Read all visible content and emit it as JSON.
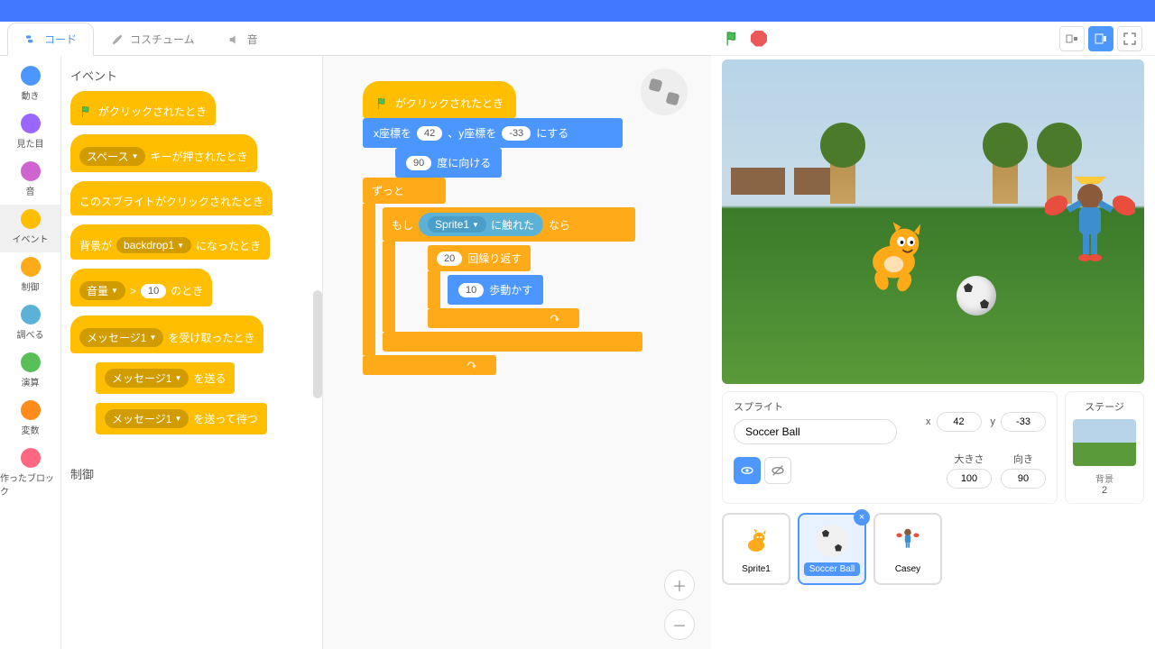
{
  "tabs": {
    "code": "コード",
    "costumes": "コスチューム",
    "sounds": "音"
  },
  "categories": [
    {
      "label": "動き",
      "color": "#4c97ff"
    },
    {
      "label": "見た目",
      "color": "#9966ff"
    },
    {
      "label": "音",
      "color": "#cf63cf"
    },
    {
      "label": "イベント",
      "color": "#ffbf00"
    },
    {
      "label": "制御",
      "color": "#ffab19"
    },
    {
      "label": "調べる",
      "color": "#5cb1d6"
    },
    {
      "label": "演算",
      "color": "#59c059"
    },
    {
      "label": "変数",
      "color": "#ff8c1a"
    },
    {
      "label": "作ったブロック",
      "color": "#ff6680"
    }
  ],
  "palette": {
    "header1": "イベント",
    "when_flag": "がクリックされたとき",
    "when_key_1": "スペース",
    "when_key_2": "キーが押されたとき",
    "when_sprite": "このスブライトがクリックされたとき",
    "when_backdrop_1": "背景が",
    "when_backdrop_val": "backdrop1",
    "when_backdrop_2": "になったとき",
    "when_loud_1": "音量",
    "when_loud_gt": ">",
    "when_loud_val": "10",
    "when_loud_2": "のとき",
    "when_receive_1": "メッセージ1",
    "when_receive_2": "を受け取ったとき",
    "broadcast_1": "メッセージ1",
    "broadcast_2": "を送る",
    "broadcast_wait_1": "メッセージ1",
    "broadcast_wait_2": "を送って待つ",
    "header2": "制御"
  },
  "script": {
    "when_flag": "がクリックされたとき",
    "goto_1": "x座標を",
    "goto_x": "42",
    "goto_2": "、y座標を",
    "goto_y": "-33",
    "goto_3": "にする",
    "point_deg": "90",
    "point_2": "度に向ける",
    "forever": "ずっと",
    "if_1": "もし",
    "if_touch_val": "Sprite1",
    "if_touch_2": "に触れた",
    "if_2": "なら",
    "repeat_n": "20",
    "repeat_2": "回繰り返す",
    "move_n": "10",
    "move_2": "歩動かす"
  },
  "sprite_panel": {
    "label": "スプライト",
    "name": "Soccer Ball",
    "x_label": "x",
    "x": "42",
    "y_label": "y",
    "y": "-33",
    "size_label": "大きさ",
    "size": "100",
    "dir_label": "向き",
    "dir": "90"
  },
  "stage_panel": {
    "label": "ステージ",
    "backdrop_label": "背景",
    "backdrop_count": "2"
  },
  "sprites": [
    {
      "name": "Sprite1"
    },
    {
      "name": "Soccer Ball"
    },
    {
      "name": "Casey"
    }
  ]
}
